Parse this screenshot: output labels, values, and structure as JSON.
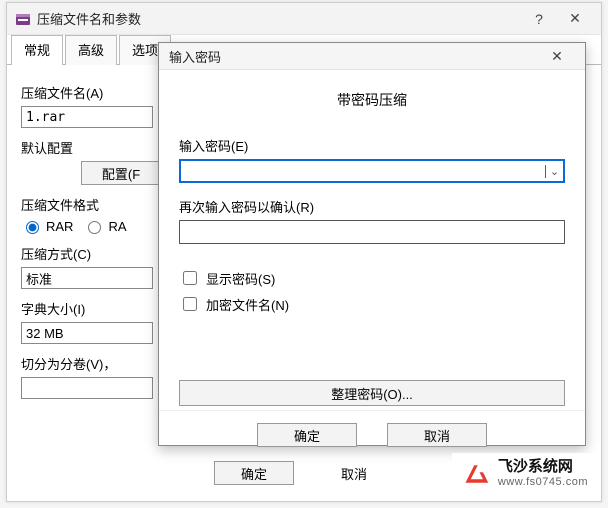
{
  "main": {
    "title": "压缩文件名和参数",
    "help_btn": "?",
    "close_btn": "✕",
    "tabs": [
      "常规",
      "高级",
      "选项"
    ],
    "archive_name_label": "压缩文件名(A)",
    "archive_name_value": "1.rar",
    "default_profile_label": "默认配置",
    "profile_button": "配置(F",
    "format_label": "压缩文件格式",
    "format_rar": "RAR",
    "format_rar4": "RA",
    "method_label": "压缩方式(C)",
    "method_value": "标准",
    "dict_label": "字典大小(I)",
    "dict_value": "32 MB",
    "split_label": "切分为分卷(V)，",
    "ok": "确定",
    "cancel": "取消"
  },
  "modal": {
    "title": "输入密码",
    "close_btn": "✕",
    "heading": "带密码压缩",
    "password_label": "输入密码(E)",
    "confirm_label": "再次输入密码以确认(R)",
    "show_password": "显示密码(S)",
    "encrypt_names": "加密文件名(N)",
    "organize": "整理密码(O)...",
    "ok": "确定",
    "cancel": "取消"
  },
  "watermark": {
    "name": "飞沙系统网",
    "url": "www.fs0745.com"
  }
}
